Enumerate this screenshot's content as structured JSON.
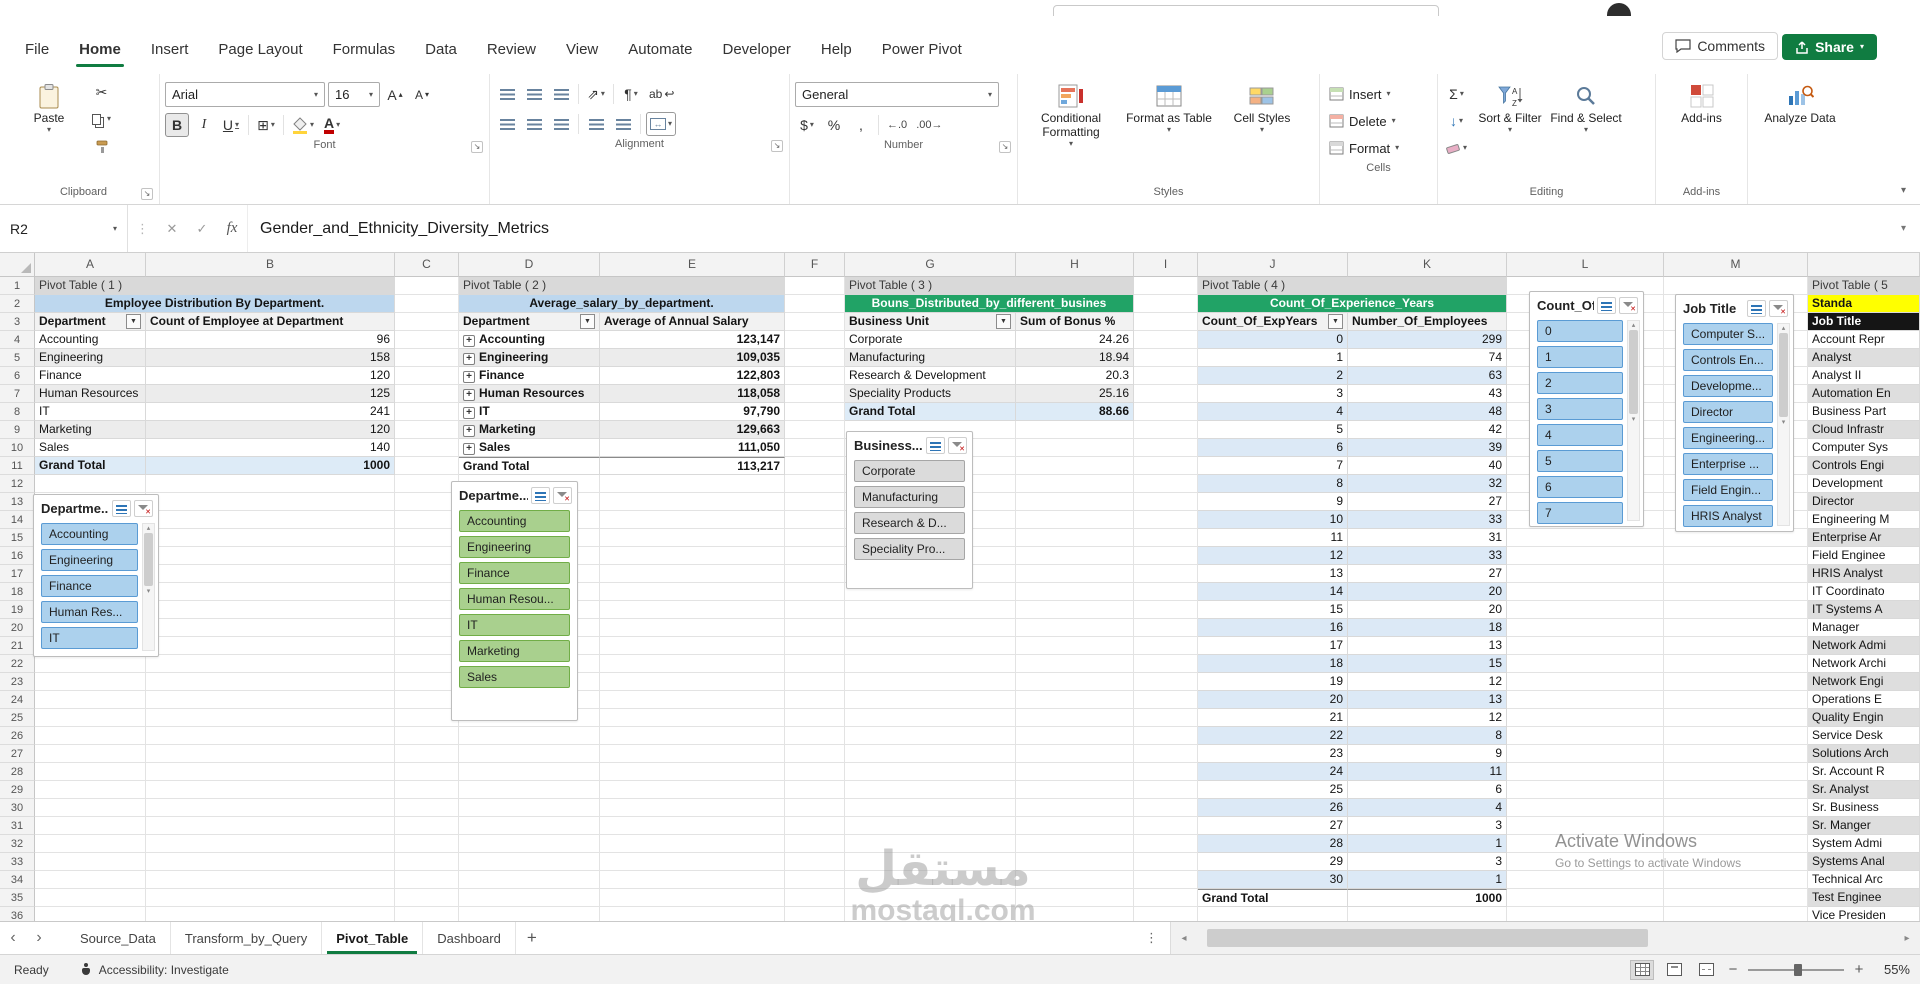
{
  "ribbon": {
    "tabs": [
      "File",
      "Home",
      "Insert",
      "Page Layout",
      "Formulas",
      "Data",
      "Review",
      "View",
      "Automate",
      "Developer",
      "Help",
      "Power Pivot"
    ],
    "active_tab": "Home",
    "comments_label": "Comments",
    "share_label": "Share",
    "clipboard": {
      "label": "Clipboard",
      "paste": "Paste"
    },
    "font": {
      "label": "Font",
      "name": "Arial",
      "size": "16",
      "bold": "B",
      "italic": "I",
      "underline": "U"
    },
    "alignment": {
      "label": "Alignment",
      "wrap": "ab"
    },
    "number": {
      "label": "Number",
      "format": "General",
      "currency": "$",
      "percent": "%",
      "comma": ",",
      "increase_decimal": "←.0",
      "decrease_decimal": ".00→"
    },
    "styles": {
      "label": "Styles",
      "conditional": "Conditional Formatting",
      "format_table": "Format as Table",
      "cell_styles": "Cell Styles"
    },
    "cells": {
      "label": "Cells",
      "insert": "Insert",
      "delete": "Delete",
      "format": "Format"
    },
    "editing": {
      "label": "Editing",
      "autosum": "Σ",
      "fill": "↓",
      "sort_filter": "Sort & Filter",
      "find_select": "Find & Select"
    },
    "addins": {
      "label": "Add-ins",
      "button": "Add-ins",
      "analyze": "Analyze Data"
    }
  },
  "formula_bar": {
    "name_box": "R2",
    "fx": "fx",
    "formula": "Gender_and_Ethnicity_Diversity_Metrics"
  },
  "grid": {
    "column_letters": [
      "A",
      "B",
      "C",
      "D",
      "E",
      "F",
      "G",
      "H",
      "I",
      "J",
      "K",
      "L",
      "M",
      ""
    ],
    "rows": 36
  },
  "pivot_tables": [
    {
      "name": "Pivot Table ( 1 )",
      "title": "Employee Distribution By Department.",
      "headers": [
        "Department",
        "Count of Employee at Department"
      ],
      "rows": [
        [
          "Accounting",
          "96"
        ],
        [
          "Engineering",
          "158"
        ],
        [
          "Finance",
          "120"
        ],
        [
          "Human Resources",
          "125"
        ],
        [
          "IT",
          "241"
        ],
        [
          "Marketing",
          "120"
        ],
        [
          "Sales",
          "140"
        ]
      ],
      "total": [
        "Grand Total",
        "1000"
      ]
    },
    {
      "name": "Pivot Table ( 2 )",
      "title": "Average_salary_by_department.",
      "headers": [
        "Department",
        "Average of Annual Salary"
      ],
      "rows": [
        [
          "Accounting",
          "123,147"
        ],
        [
          "Engineering",
          "109,035"
        ],
        [
          "Finance",
          "122,803"
        ],
        [
          "Human Resources",
          "118,058"
        ],
        [
          "IT",
          "97,790"
        ],
        [
          "Marketing",
          "129,663"
        ],
        [
          "Sales",
          "111,050"
        ]
      ],
      "total": [
        "Grand Total",
        "113,217"
      ]
    },
    {
      "name": "Pivot Table ( 3 )",
      "title": "Bouns_Distributed_by_different_busines",
      "headers": [
        "Business Unit",
        "Sum of Bonus %"
      ],
      "rows": [
        [
          "Corporate",
          "24.26"
        ],
        [
          "Manufacturing",
          "18.94"
        ],
        [
          "Research & Development",
          "20.3"
        ],
        [
          "Speciality Products",
          "25.16"
        ]
      ],
      "total": [
        "Grand Total",
        "88.66"
      ]
    },
    {
      "name": "Pivot Table ( 4 )",
      "title": "Count_Of_Experience_Years",
      "headers": [
        "Count_Of_ExpYears",
        "Number_Of_Employees"
      ],
      "rows": [
        [
          "0",
          "299"
        ],
        [
          "1",
          "74"
        ],
        [
          "2",
          "63"
        ],
        [
          "3",
          "43"
        ],
        [
          "4",
          "48"
        ],
        [
          "5",
          "42"
        ],
        [
          "6",
          "39"
        ],
        [
          "7",
          "40"
        ],
        [
          "8",
          "32"
        ],
        [
          "9",
          "27"
        ],
        [
          "10",
          "33"
        ],
        [
          "11",
          "31"
        ],
        [
          "12",
          "33"
        ],
        [
          "13",
          "27"
        ],
        [
          "14",
          "20"
        ],
        [
          "15",
          "20"
        ],
        [
          "16",
          "18"
        ],
        [
          "17",
          "13"
        ],
        [
          "18",
          "15"
        ],
        [
          "19",
          "12"
        ],
        [
          "20",
          "13"
        ],
        [
          "21",
          "12"
        ],
        [
          "22",
          "8"
        ],
        [
          "23",
          "9"
        ],
        [
          "24",
          "11"
        ],
        [
          "25",
          "6"
        ],
        [
          "26",
          "4"
        ],
        [
          "27",
          "3"
        ],
        [
          "28",
          "1"
        ],
        [
          "29",
          "3"
        ],
        [
          "30",
          "1"
        ]
      ],
      "total": [
        "Grand Total",
        "1000"
      ]
    },
    {
      "name": "Pivot Table ( 5",
      "title": "Standa",
      "headers": [
        "Job Title"
      ],
      "rows": [
        "Account Repr",
        "Analyst",
        "Analyst II",
        "Automation En",
        "Business Part",
        "Cloud Infrastr",
        "Computer Sys",
        "Controls Engi",
        "Development",
        "Director",
        "Engineering M",
        "Enterprise Ar",
        "Field Enginee",
        "HRIS Analyst",
        "IT Coordinato",
        "IT Systems A",
        "Manager",
        "Network Admi",
        "Network Archi",
        "Network Engi",
        "Operations E",
        "Quality Engin",
        "Service Desk",
        "Solutions Arch",
        "Sr. Account R",
        "Sr. Analyst",
        "Sr. Business",
        "Sr. Manger",
        "System Admi",
        "Systems Anal",
        "Technical Arc",
        "Test Enginee",
        "Vice Presiden"
      ]
    }
  ],
  "slicers": [
    {
      "title": "Departme...",
      "color": "blue",
      "items": [
        "Accounting",
        "Engineering",
        "Finance",
        "Human Res...",
        "IT"
      ]
    },
    {
      "title": "Departme...",
      "color": "green",
      "items": [
        "Accounting",
        "Engineering",
        "Finance",
        "Human Resou...",
        "IT",
        "Marketing",
        "Sales"
      ]
    },
    {
      "title": "Business...",
      "color": "gray",
      "items": [
        "Corporate",
        "Manufacturing",
        "Research & D...",
        "Speciality Pro..."
      ]
    },
    {
      "title": "Count_Of...",
      "color": "blue",
      "items": [
        "0",
        "1",
        "2",
        "3",
        "4",
        "5",
        "6",
        "7"
      ]
    },
    {
      "title": "Job Title",
      "color": "blue",
      "items": [
        "Computer S...",
        "Controls En...",
        "Developme...",
        "Director",
        "Engineering...",
        "Enterprise ...",
        "Field Engin...",
        "HRIS Analyst"
      ]
    }
  ],
  "icons": {
    "dropdown_caret": "▾",
    "filter_arrow": "▼",
    "expand_plus": "+",
    "scroll_up": "▴",
    "scroll_down": "▾",
    "cut": "✂",
    "borders": "⊞",
    "orientation": "⇗",
    "pilcrow": "¶",
    "wrap_return": "↩"
  },
  "sheet_tabs": {
    "nav_left": "‹",
    "nav_right": "›",
    "tabs": [
      "Source_Data",
      "Transform_by_Query",
      "Pivot_Table",
      "Dashboard"
    ],
    "active": "Pivot_Table",
    "add": "+"
  },
  "status_bar": {
    "ready": "Ready",
    "accessibility": "Accessibility: Investigate",
    "zoom": "55%"
  },
  "overlays": {
    "watermark_line1": "مستقل",
    "watermark_line2": "mostaql.com",
    "activate_line1": "Activate Windows",
    "activate_line2": "Go to Settings to activate Windows"
  }
}
